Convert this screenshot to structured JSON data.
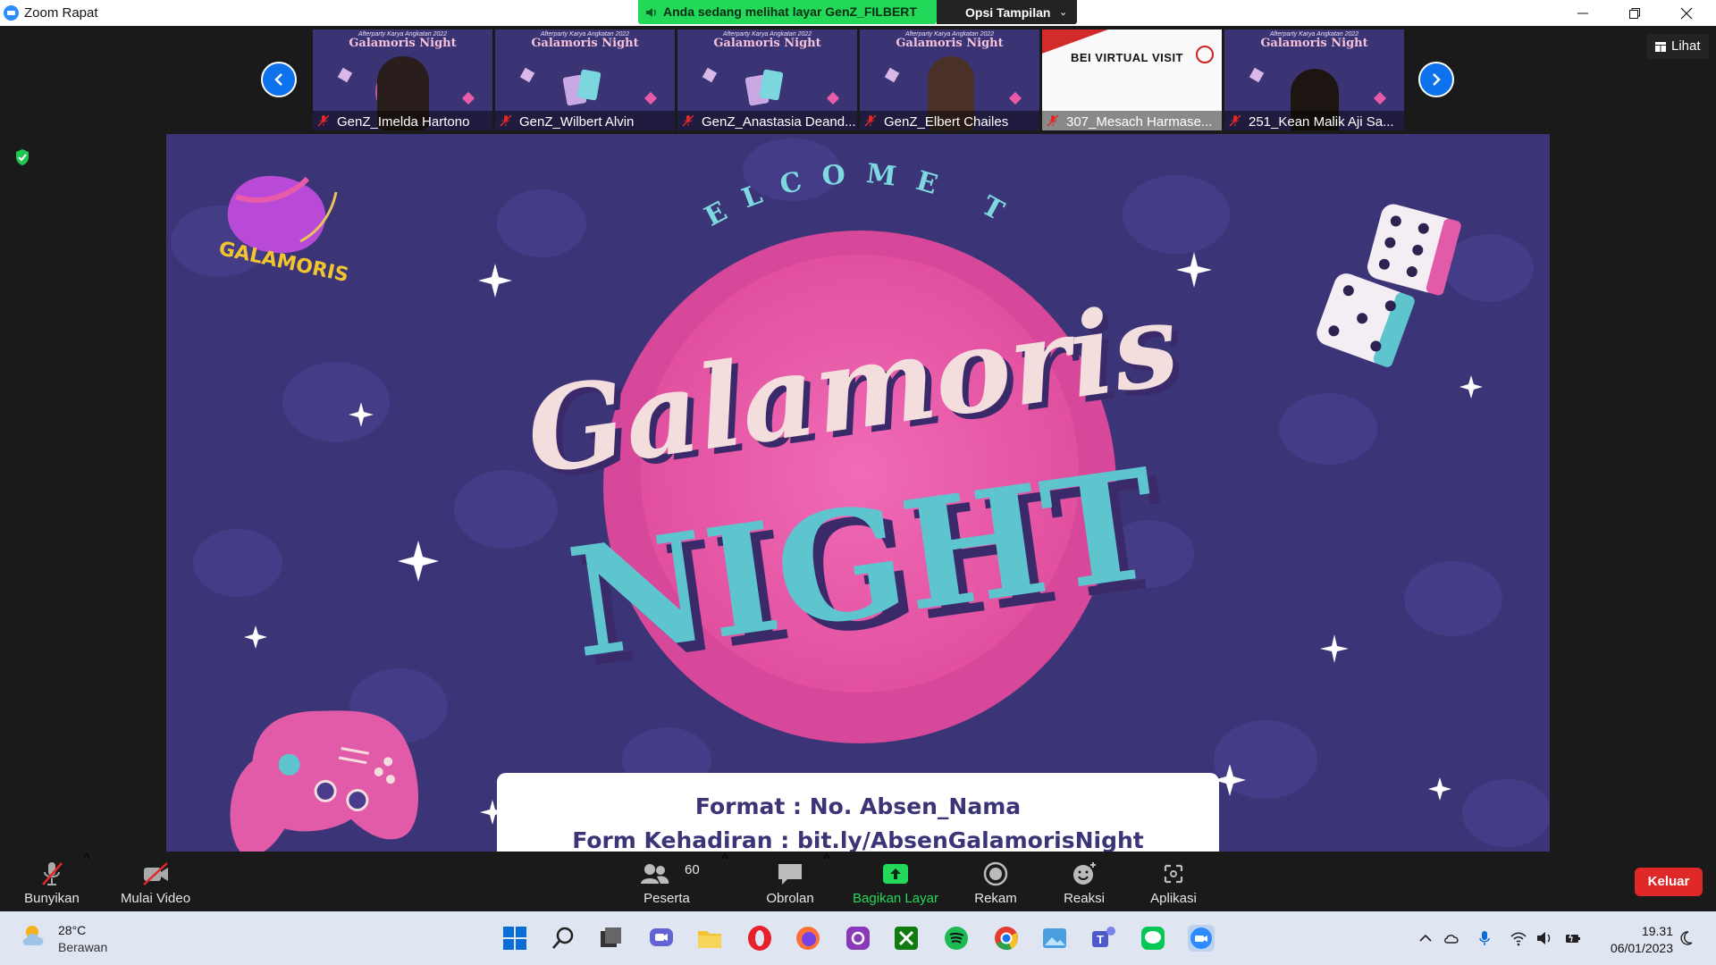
{
  "window": {
    "title": "Zoom Rapat",
    "share_banner": "Anda sedang melihat layar GenZ_FILBERT",
    "view_options": "Opsi Tampilan"
  },
  "gallery": {
    "view_label": "Lihat",
    "participants": [
      {
        "name": "GenZ_Imelda Hartono",
        "muted": true,
        "thumbnail": "slide-with-person"
      },
      {
        "name": "GenZ_Wilbert Alvin",
        "muted": true,
        "thumbnail": "slide"
      },
      {
        "name": "GenZ_Anastasia Deand...",
        "muted": true,
        "thumbnail": "slide"
      },
      {
        "name": "GenZ_Elbert Chailes",
        "muted": true,
        "thumbnail": "slide-with-person"
      },
      {
        "name": "307_Mesach Harmase...",
        "muted": true,
        "thumbnail": "bei-virtual-visit"
      },
      {
        "name": "251_Kean Malik Aji Sa...",
        "muted": true,
        "thumbnail": "slide-with-person"
      }
    ],
    "thumb_slide_subtitle": "Afterparty Karya Angkatan 2022",
    "thumb_slide_title": "Galamoris Night",
    "bei_text": "BEI VIRTUAL VISIT"
  },
  "shared_slide": {
    "logo_text": "GALAMORIS",
    "welcome": "WELCOME TO",
    "script_title": "Galamoris",
    "big_title": "NIGHT",
    "format_line": "Format : No. Absen_Nama",
    "form_line": "Form Kehadiran : bit.ly/AbsenGalamorisNight"
  },
  "toolbar": {
    "unmute": "Bunyikan",
    "start_video": "Mulai Video",
    "participants": "Peserta",
    "participant_count": "60",
    "chat": "Obrolan",
    "share": "Bagikan Layar",
    "record": "Rekam",
    "reactions": "Reaksi",
    "apps": "Aplikasi",
    "leave": "Keluar"
  },
  "taskbar": {
    "temperature": "28°C",
    "condition": "Berawan",
    "time": "19.31",
    "date": "06/01/2023"
  },
  "colors": {
    "slide_bg": "#3b3477",
    "pink": "#e25ba9",
    "teal": "#5ec5cf",
    "cream": "#f1dede",
    "zoom_blue": "#0e72ed",
    "share_green": "#23d959",
    "leave_red": "#e02828"
  }
}
